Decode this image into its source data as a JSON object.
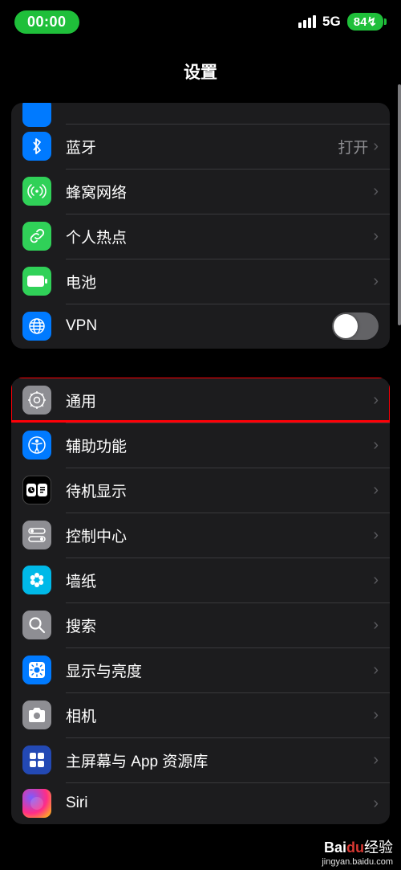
{
  "status": {
    "time": "00:00",
    "network": "5G",
    "battery": "84"
  },
  "title": "设置",
  "group1": [
    {
      "id": "bluetooth",
      "label": "蓝牙",
      "value": "打开",
      "bg": "#007aff"
    },
    {
      "id": "cellular",
      "label": "蜂窝网络",
      "bg": "#30d158"
    },
    {
      "id": "hotspot",
      "label": "个人热点",
      "bg": "#30d158"
    },
    {
      "id": "battery",
      "label": "电池",
      "bg": "#30d158"
    },
    {
      "id": "vpn",
      "label": "VPN",
      "bg": "#007aff",
      "toggle": false
    }
  ],
  "group2": [
    {
      "id": "general",
      "label": "通用",
      "bg": "#8e8e93",
      "hl": true
    },
    {
      "id": "accessibility",
      "label": "辅助功能",
      "bg": "#007aff"
    },
    {
      "id": "standby",
      "label": "待机显示",
      "bg": "#000",
      "border": true
    },
    {
      "id": "controlcenter",
      "label": "控制中心",
      "bg": "#8e8e93"
    },
    {
      "id": "wallpaper",
      "label": "墙纸",
      "bg": "#00b9e8"
    },
    {
      "id": "search",
      "label": "搜索",
      "bg": "#8e8e93"
    },
    {
      "id": "display",
      "label": "显示与亮度",
      "bg": "#007aff"
    },
    {
      "id": "camera",
      "label": "相机",
      "bg": "#8e8e93"
    },
    {
      "id": "homescreen",
      "label": "主屏幕与 App 资源库",
      "bg": "#2349b4"
    },
    {
      "id": "siri",
      "label": "Siri",
      "siri": true
    }
  ],
  "watermark": {
    "brand_a": "Bai",
    "brand_b": "du",
    "brand_c": "经验",
    "url": "jingyan.baidu.com"
  }
}
